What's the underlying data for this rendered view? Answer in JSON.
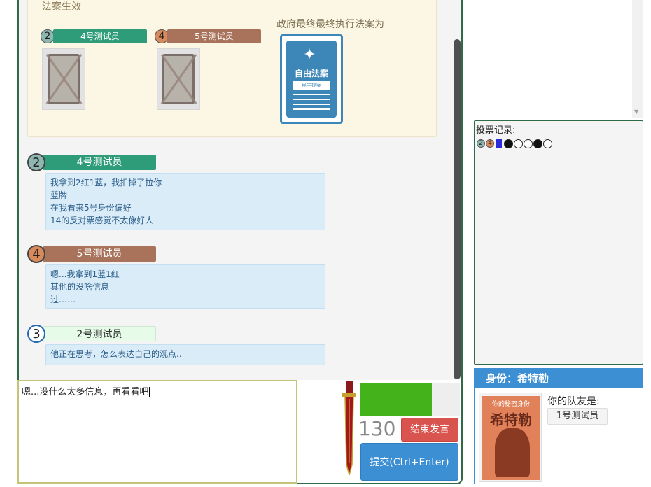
{
  "law_section": {
    "title": "法案生效",
    "president": {
      "number": "2",
      "name": "4号测试员"
    },
    "chancellor": {
      "number": "4",
      "name": "5号测试员"
    },
    "gov_text": "政府最终最终执行法案为",
    "law_card_label": "自由法案",
    "law_card_sub": "民主提案"
  },
  "messages": [
    {
      "number": "2",
      "name": "4号测试员",
      "color": "#2e9c78",
      "lines": [
        "我拿到2红1蓝，我扣掉了拉你",
        "蓝牌",
        "在我看来5号身份偏好",
        "14的反对票感觉不太像好人"
      ]
    },
    {
      "number": "4",
      "name": "5号测试员",
      "color": "#a8735a",
      "lines": [
        "嗯...我拿到1蓝1红",
        "其他的没啥信息",
        "过……"
      ]
    },
    {
      "number": "3",
      "name": "2号测试员",
      "color": "#e6fbe8",
      "lines": [
        "他正在思考，怎么表达自己的观点.."
      ]
    }
  ],
  "input": {
    "value": "嗯...没什么太多信息，再看看吧"
  },
  "timer": {
    "value": "130",
    "progress_fraction": 0.72
  },
  "buttons": {
    "end_speech": "结束发言",
    "submit": "提交(Ctrl+Enter)"
  },
  "vote_record": {
    "title": "投票记录:",
    "row": {
      "numbers": [
        "2",
        "4"
      ],
      "dots": [
        "black",
        "white",
        "white",
        "black",
        "white"
      ]
    }
  },
  "identity": {
    "header": "身份：希特勒",
    "card_top_text": "你的秘密身份",
    "card_name": "希特勒",
    "teammate_label": "你的队友是:",
    "teammate": "1号测试员"
  },
  "colors": {
    "accent_blue": "#3c8fd3",
    "liberal_blue": "#3d87b8",
    "timer_green": "#44b31b",
    "end_red": "#d9534f"
  }
}
